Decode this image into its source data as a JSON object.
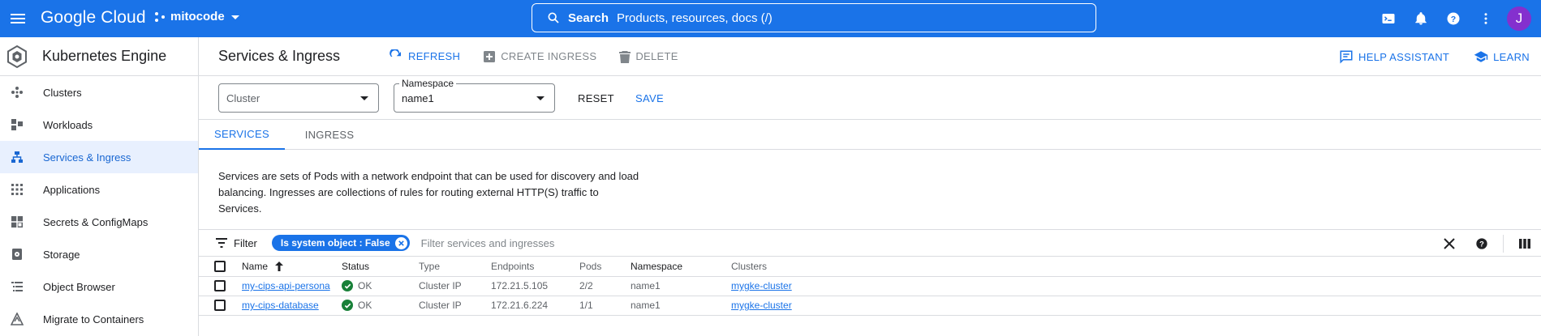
{
  "topbar": {
    "brand": "Google Cloud",
    "project": "mitocode",
    "search_label": "Search",
    "search_hint": "Products, resources, docs (/)",
    "avatar_initial": "J"
  },
  "sidebar": {
    "product_title": "Kubernetes Engine",
    "items": [
      {
        "label": "Clusters",
        "icon": "clusters-icon"
      },
      {
        "label": "Workloads",
        "icon": "workloads-icon"
      },
      {
        "label": "Services & Ingress",
        "icon": "services-icon",
        "active": true
      },
      {
        "label": "Applications",
        "icon": "applications-icon"
      },
      {
        "label": "Secrets & ConfigMaps",
        "icon": "secrets-icon"
      },
      {
        "label": "Storage",
        "icon": "storage-icon"
      },
      {
        "label": "Object Browser",
        "icon": "object-browser-icon"
      },
      {
        "label": "Migrate to Containers",
        "icon": "migrate-icon"
      }
    ]
  },
  "header": {
    "title": "Services & Ingress",
    "refresh": "REFRESH",
    "create_ingress": "CREATE INGRESS",
    "delete": "DELETE",
    "help_assistant": "HELP ASSISTANT",
    "learn": "LEARN"
  },
  "filters": {
    "cluster_placeholder": "Cluster",
    "namespace_label": "Namespace",
    "namespace_value": "name1",
    "reset": "RESET",
    "save": "SAVE"
  },
  "tabs": [
    {
      "label": "SERVICES",
      "active": true
    },
    {
      "label": "INGRESS",
      "active": false
    }
  ],
  "description": "Services are sets of Pods with a network endpoint that can be used for discovery and load balancing. Ingresses are collections of rules for routing external HTTP(S) traffic to Services.",
  "filter_bar": {
    "label": "Filter",
    "chip": "Is system object : False",
    "placeholder": "Filter services and ingresses"
  },
  "table": {
    "headers": [
      "Name",
      "Status",
      "Type",
      "Endpoints",
      "Pods",
      "Namespace",
      "Clusters"
    ],
    "rows": [
      {
        "name": "my-cips-api-persona",
        "status": "OK",
        "type": "Cluster IP",
        "endpoints": "172.21.5.105",
        "pods": "2/2",
        "namespace": "name1",
        "cluster": "mygke-cluster"
      },
      {
        "name": "my-cips-database",
        "status": "OK",
        "type": "Cluster IP",
        "endpoints": "172.21.6.224",
        "pods": "1/1",
        "namespace": "name1",
        "cluster": "mygke-cluster"
      }
    ]
  },
  "colors": {
    "brand_blue": "#1a73e8",
    "ok_green": "#188038",
    "avatar_purple": "#8430ce"
  }
}
